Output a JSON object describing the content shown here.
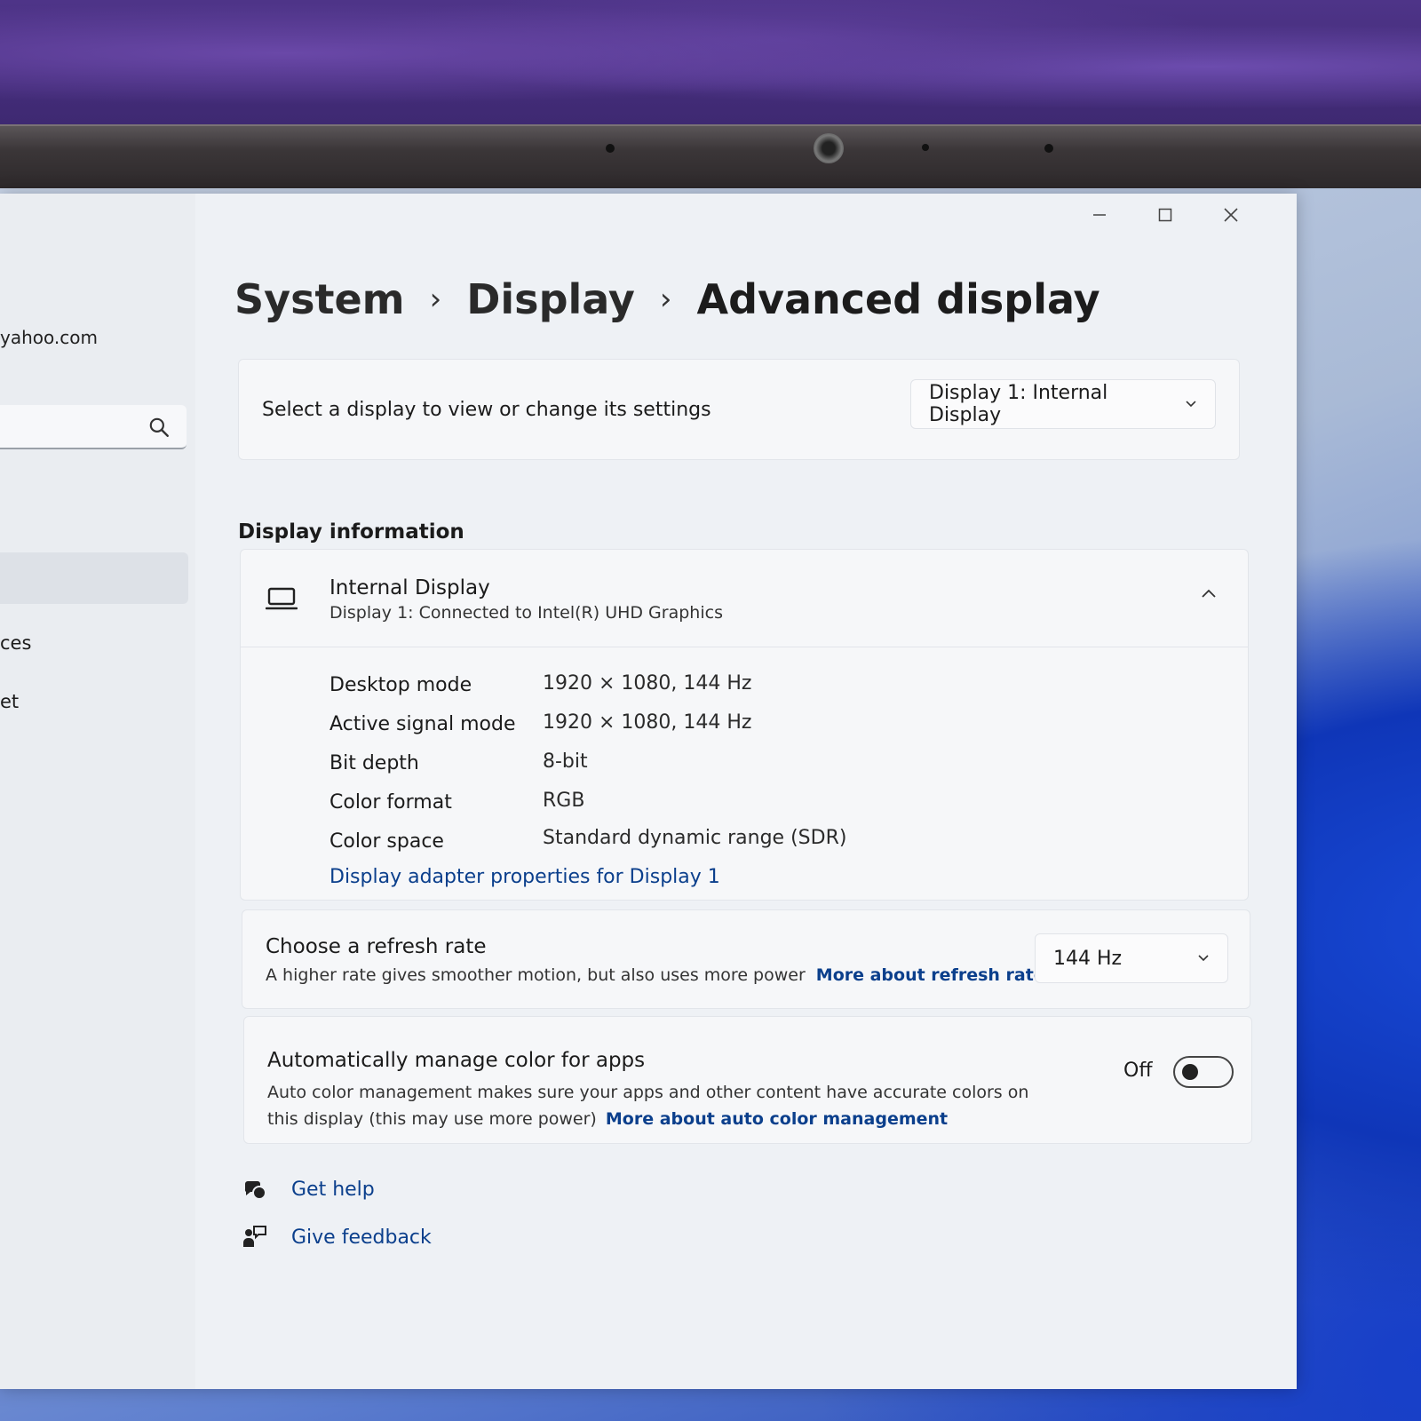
{
  "breadcrumb": {
    "system": "System",
    "display": "Display",
    "current": "Advanced display",
    "separator": "›"
  },
  "sidebar": {
    "account_email": "yahoo.com",
    "items": [
      {
        "label": "ces"
      },
      {
        "label": "et"
      }
    ]
  },
  "window_controls": {
    "minimize_icon": "minimize-icon",
    "maximize_icon": "maximize-icon",
    "close_icon": "close-icon"
  },
  "display_select": {
    "label": "Select a display to view or change its settings",
    "selected": "Display 1: Internal Display"
  },
  "display_information": {
    "section_title": "Display information",
    "name": "Internal Display",
    "subtitle": "Display 1: Connected to Intel(R) UHD Graphics",
    "rows": [
      {
        "label": "Desktop mode",
        "value": "1920 × 1080, 144 Hz"
      },
      {
        "label": "Active signal mode",
        "value": "1920 × 1080, 144 Hz"
      },
      {
        "label": "Bit depth",
        "value": "8-bit"
      },
      {
        "label": "Color format",
        "value": "RGB"
      },
      {
        "label": "Color space",
        "value": "Standard dynamic range (SDR)"
      }
    ],
    "adapter_link": "Display adapter properties for Display 1"
  },
  "refresh_rate": {
    "title": "Choose a refresh rate",
    "description": "A higher rate gives smoother motion, but also uses more power",
    "link": "More about refresh rate",
    "selected": "144 Hz"
  },
  "auto_color": {
    "title": "Automatically manage color for apps",
    "description": "Auto color management makes sure your apps and other content have accurate colors on this display (this may use more power)",
    "link": "More about auto color management",
    "toggle_label": "Off",
    "toggle_on": false
  },
  "footer": {
    "get_help": "Get help",
    "give_feedback": "Give feedback"
  },
  "colors": {
    "accent_link": "#0b3f8c",
    "window_bg": "#eef1f5"
  }
}
